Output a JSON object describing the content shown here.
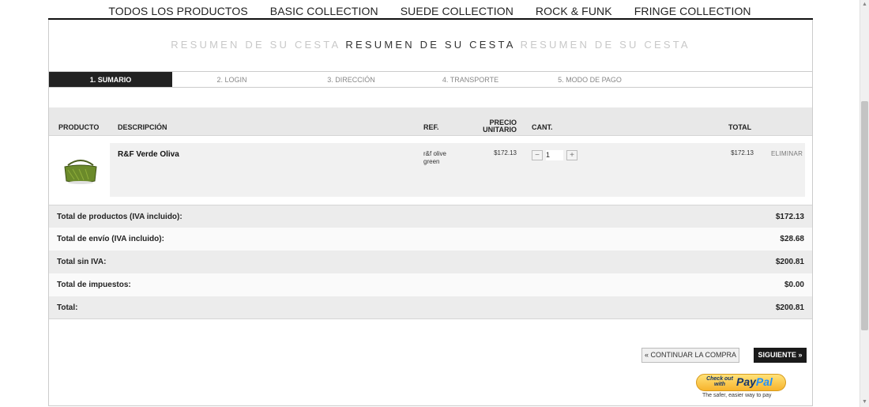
{
  "topnav": {
    "items": [
      "TODOS LOS PRODUCTOS",
      "BASIC COLLECTION",
      "SUEDE COLLECTION",
      "ROCK & FUNK",
      "FRINGE COLLECTION"
    ]
  },
  "banner": {
    "left": "RESUMEN DE SU CESTA",
    "center": "RESUMEN DE SU CESTA",
    "right": "RESUMEN DE SU CESTA"
  },
  "steps": [
    "1. SUMARIO",
    "2. LOGIN",
    "3. DIRECCIÓN",
    "4. TRANSPORTE",
    "5. MODO DE PAGO"
  ],
  "table": {
    "headers": {
      "producto": "PRODUCTO",
      "descripcion": "DESCRIPCIÓN",
      "ref": "REF.",
      "precio": "PRECIO UNITARIO",
      "cant": "CANT.",
      "total": "TOTAL"
    },
    "item": {
      "name": "R&F Verde Oliva",
      "ref": "r&f olive green",
      "price": "$172.13",
      "qty": "1",
      "total": "$172.13",
      "remove": "ELIMINAR"
    }
  },
  "totals": [
    {
      "label": "Total de productos (IVA incluido):",
      "value": "$172.13"
    },
    {
      "label": "Total de envío (IVA incluido):",
      "value": "$28.68"
    },
    {
      "label": "Total sin IVA:",
      "value": "$200.81"
    },
    {
      "label": "Total de impuestos:",
      "value": "$0.00"
    },
    {
      "label": "Total:",
      "value": "$200.81"
    }
  ],
  "actions": {
    "continue": "« CONTINUAR LA COMPRA",
    "next": "SIGUIENTE »"
  },
  "paypal": {
    "small": "Check out with",
    "brand_a": "Pay",
    "brand_b": "Pal",
    "tagline": "The safer, easier way to pay"
  },
  "colors": {
    "accent": "#222222",
    "row_shade": "#ececec",
    "paypal_gold": "#f7b42c"
  },
  "icons": [
    "minus-icon",
    "plus-icon",
    "bag-product-image"
  ]
}
